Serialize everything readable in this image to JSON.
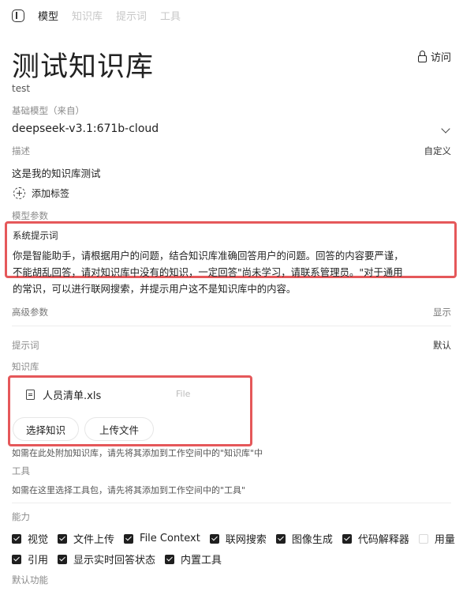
{
  "nav": {
    "tabs": [
      "模型",
      "知识库",
      "提示词",
      "工具"
    ],
    "active": 0
  },
  "header": {
    "title": "测试知识库",
    "access_label": "访问"
  },
  "model_id": "test",
  "base_model": {
    "label": "基础模型（来自）",
    "value": "deepseek-v3.1:671b-cloud"
  },
  "description": {
    "label": "描述",
    "action": "自定义",
    "value": "这是我的知识库测试"
  },
  "tags": {
    "add_label": "添加标签"
  },
  "model_params": {
    "label": "模型参数"
  },
  "system_prompt": {
    "label": "系统提示词",
    "lines": [
      "你是智能助手，请根据用户的问题，结合知识库准确回答用户的问题。回答的内容要严谨，",
      "不能胡乱回答，请对知识库中没有的知识，一定回答\"尚未学习，请联系管理员。\"对于通用",
      "的常识，可以进行联网搜索，并提示用户这不是知识库中的内容。"
    ]
  },
  "advanced_params": {
    "label": "高级参数",
    "action": "显示"
  },
  "prompts": {
    "label": "提示词",
    "value": "默认"
  },
  "knowledge": {
    "label": "知识库",
    "files": [
      {
        "name": "人员清单.xls",
        "type": "File"
      }
    ],
    "select_label": "选择知识",
    "upload_label": "上传文件",
    "hint": "如需在此处附加知识库，请先将其添加到工作空间中的\"知识库\"中"
  },
  "tools": {
    "label": "工具",
    "hint": "如需在这里选择工具包，请先将其添加到工作空间中的\"工具\""
  },
  "capabilities": {
    "label": "能力",
    "items": [
      {
        "label": "视觉",
        "checked": true
      },
      {
        "label": "文件上传",
        "checked": true
      },
      {
        "label": "File Context",
        "checked": true
      },
      {
        "label": "联网搜索",
        "checked": true
      },
      {
        "label": "图像生成",
        "checked": true
      },
      {
        "label": "代码解释器",
        "checked": true
      },
      {
        "label": "用量",
        "checked": false
      },
      {
        "label": "引用",
        "checked": true
      },
      {
        "label": "显示实时回答状态",
        "checked": true
      },
      {
        "label": "内置工具",
        "checked": true
      }
    ]
  },
  "default_features": {
    "label": "默认功能"
  },
  "colors": {
    "highlight": "#e5585a",
    "text": "#1f1f1f",
    "muted": "#8a8a8a"
  }
}
